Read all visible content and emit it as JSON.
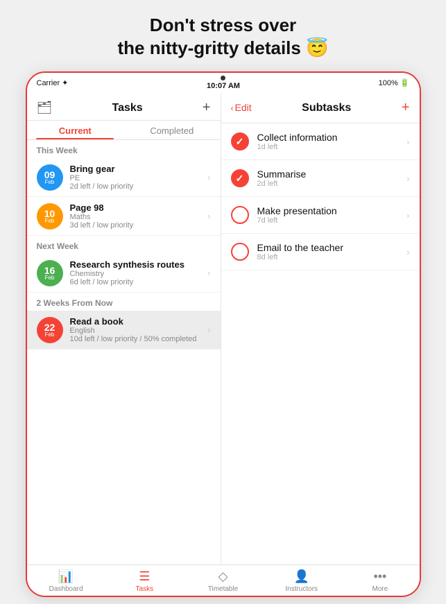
{
  "headline": {
    "line1": "Don't stress over",
    "line2": "the nitty-gritty details 😇"
  },
  "status_bar": {
    "carrier": "Carrier ✦",
    "time": "10:07 AM",
    "battery": "100% 🔋"
  },
  "left_panel": {
    "title": "Tasks",
    "plus_label": "+",
    "tabs": [
      {
        "label": "Current",
        "active": true
      },
      {
        "label": "Completed",
        "active": false
      }
    ],
    "sections": [
      {
        "label": "This Week",
        "tasks": [
          {
            "day": "09",
            "month": "Feb",
            "color": "#2196F3",
            "title": "Bring gear",
            "subtitle": "PE",
            "detail": "2d left / low priority",
            "selected": false
          },
          {
            "day": "10",
            "month": "Feb",
            "color": "#FF9800",
            "title": "Page 98",
            "subtitle": "Maths",
            "detail": "3d left / low priority",
            "selected": false
          }
        ]
      },
      {
        "label": "Next Week",
        "tasks": [
          {
            "day": "16",
            "month": "Feb",
            "color": "#4CAF50",
            "title": "Research synthesis routes",
            "subtitle": "Chemistry",
            "detail": "6d left / low priority",
            "selected": false
          }
        ]
      },
      {
        "label": "2 Weeks From Now",
        "tasks": [
          {
            "day": "22",
            "month": "Feb",
            "color": "#f44336",
            "title": "Read a book",
            "subtitle": "English",
            "detail": "10d left / low priority / 50% completed",
            "selected": true
          }
        ]
      }
    ]
  },
  "right_panel": {
    "edit_label": "Edit",
    "title": "Subtasks",
    "plus_label": "+",
    "subtasks": [
      {
        "title": "Collect information",
        "time": "1d left",
        "checked": true
      },
      {
        "title": "Summarise",
        "time": "2d left",
        "checked": true
      },
      {
        "title": "Make presentation",
        "time": "7d left",
        "checked": false
      },
      {
        "title": "Email to the teacher",
        "time": "8d left",
        "checked": false
      }
    ]
  },
  "bottom_bar": {
    "tabs": [
      {
        "label": "Dashboard",
        "icon": "📊",
        "active": false
      },
      {
        "label": "Tasks",
        "icon": "☰",
        "active": true
      },
      {
        "label": "Timetable",
        "icon": "◇",
        "active": false
      },
      {
        "label": "Instructors",
        "icon": "👤",
        "active": false
      },
      {
        "label": "More",
        "icon": "•••",
        "active": false
      }
    ]
  }
}
